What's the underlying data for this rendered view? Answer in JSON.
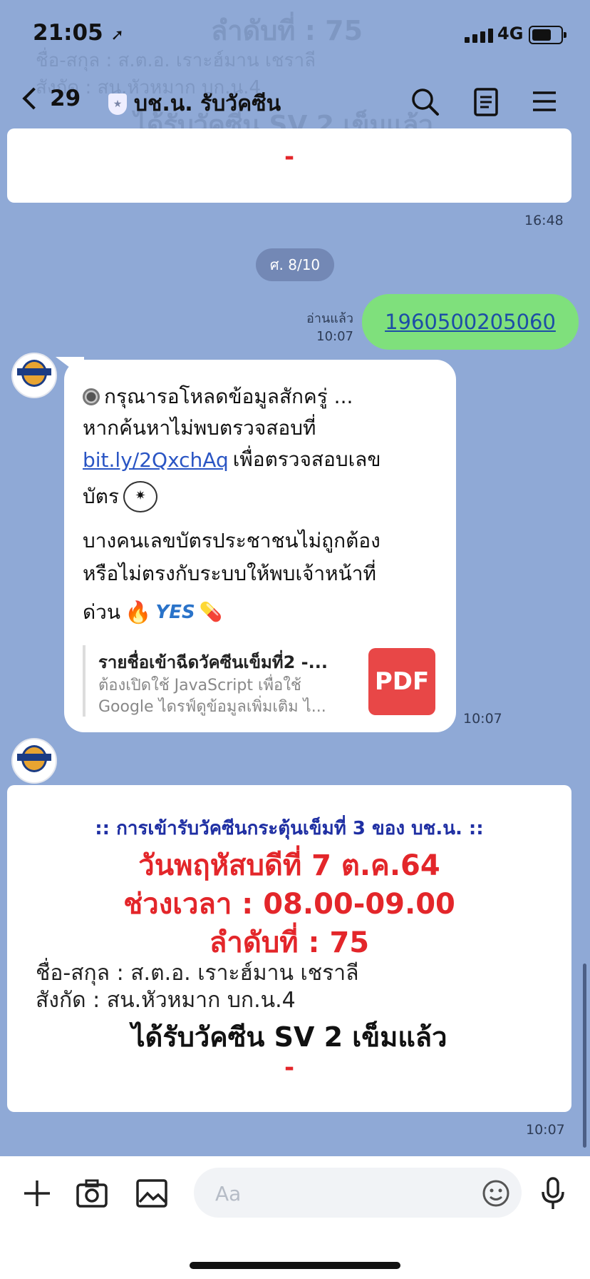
{
  "status": {
    "time": "21:05",
    "network": "4G"
  },
  "header": {
    "back_count": "29",
    "title": "บช.น. รับวัคซีน"
  },
  "ghost": {
    "line1": "ลำดับที่ : 75",
    "line2": "ชื่อ-สกุล : ส.ต.อ. เราะฮ์มาน เชราลี",
    "line3": "สังกัด : สน.หัวหมาก  บก.น.4",
    "line4": "ได้รับวัคซีน SV 2 เข็มแล้ว"
  },
  "top_card": {
    "dash": "-",
    "time": "16:48"
  },
  "date_separator": "ศ. 8/10",
  "outgoing": {
    "text": "1960500205060",
    "read_label": "อ่านแล้ว",
    "time": "10:07"
  },
  "incoming_message": {
    "line1": "กรุณารอโหลดข้อมูลสักครู่ ...",
    "line2": "หากค้นหาไม่พบตรวจสอบที่",
    "link": "bit.ly/2QxchAq",
    "line3_rest": "เพื่อตรวจสอบเลข",
    "line4": "บัตร",
    "line5": "บางคนเลขบัตรประชาชนไม่ถูกต้อง",
    "line6": "หรือไม่ตรงกับระบบให้พบเจ้าหน้าที่",
    "line7": "ด่วน",
    "yes": "YES",
    "preview": {
      "title": "รายชื่อเข้าฉีดวัคซีนเข็มที่2 -...",
      "desc1": "ต้องเปิดใช้ JavaScript เพื่อใช้",
      "desc2": "Google ไดรฟ์ดูข้อมูลเพิ่มเติม ไ...",
      "badge": "PDF"
    },
    "time": "10:07"
  },
  "vaccine_card": {
    "heading": ":: การเข้ารับวัคซีนกระตุ้นเข็มที่ 3 ของ บช.น. ::",
    "date": "วันพฤหัสบดีที่ 7 ต.ค.64",
    "timeslot": "ช่วงเวลา : 08.00-09.00",
    "order": "ลำดับที่ : 75",
    "name": "ชื่อ-สกุล : ส.ต.อ. เราะฮ์มาน เชราลี",
    "unit": "สังกัด : สน.หัวหมาก  บก.น.4",
    "received": "ได้รับวัคซีน SV 2 เข็มแล้ว",
    "dash": "-",
    "time": "10:07"
  },
  "composer": {
    "placeholder": "Aa"
  },
  "colors": {
    "background": "#8fa9d6",
    "outgoing_bubble": "#7fe07c",
    "link": "#2a55c4",
    "red": "#e3262a",
    "navy": "#1f2fa3"
  }
}
